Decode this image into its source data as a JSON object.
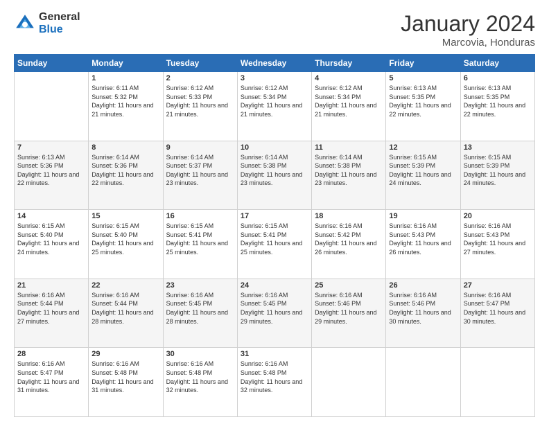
{
  "header": {
    "logo": {
      "general": "General",
      "blue": "Blue"
    },
    "title": "January 2024",
    "subtitle": "Marcovia, Honduras"
  },
  "weekdays": [
    "Sunday",
    "Monday",
    "Tuesday",
    "Wednesday",
    "Thursday",
    "Friday",
    "Saturday"
  ],
  "weeks": [
    [
      {
        "day": "",
        "sunrise": "",
        "sunset": "",
        "daylight": ""
      },
      {
        "day": "1",
        "sunrise": "Sunrise: 6:11 AM",
        "sunset": "Sunset: 5:32 PM",
        "daylight": "Daylight: 11 hours and 21 minutes."
      },
      {
        "day": "2",
        "sunrise": "Sunrise: 6:12 AM",
        "sunset": "Sunset: 5:33 PM",
        "daylight": "Daylight: 11 hours and 21 minutes."
      },
      {
        "day": "3",
        "sunrise": "Sunrise: 6:12 AM",
        "sunset": "Sunset: 5:34 PM",
        "daylight": "Daylight: 11 hours and 21 minutes."
      },
      {
        "day": "4",
        "sunrise": "Sunrise: 6:12 AM",
        "sunset": "Sunset: 5:34 PM",
        "daylight": "Daylight: 11 hours and 21 minutes."
      },
      {
        "day": "5",
        "sunrise": "Sunrise: 6:13 AM",
        "sunset": "Sunset: 5:35 PM",
        "daylight": "Daylight: 11 hours and 22 minutes."
      },
      {
        "day": "6",
        "sunrise": "Sunrise: 6:13 AM",
        "sunset": "Sunset: 5:35 PM",
        "daylight": "Daylight: 11 hours and 22 minutes."
      }
    ],
    [
      {
        "day": "7",
        "sunrise": "Sunrise: 6:13 AM",
        "sunset": "Sunset: 5:36 PM",
        "daylight": "Daylight: 11 hours and 22 minutes."
      },
      {
        "day": "8",
        "sunrise": "Sunrise: 6:14 AM",
        "sunset": "Sunset: 5:36 PM",
        "daylight": "Daylight: 11 hours and 22 minutes."
      },
      {
        "day": "9",
        "sunrise": "Sunrise: 6:14 AM",
        "sunset": "Sunset: 5:37 PM",
        "daylight": "Daylight: 11 hours and 23 minutes."
      },
      {
        "day": "10",
        "sunrise": "Sunrise: 6:14 AM",
        "sunset": "Sunset: 5:38 PM",
        "daylight": "Daylight: 11 hours and 23 minutes."
      },
      {
        "day": "11",
        "sunrise": "Sunrise: 6:14 AM",
        "sunset": "Sunset: 5:38 PM",
        "daylight": "Daylight: 11 hours and 23 minutes."
      },
      {
        "day": "12",
        "sunrise": "Sunrise: 6:15 AM",
        "sunset": "Sunset: 5:39 PM",
        "daylight": "Daylight: 11 hours and 24 minutes."
      },
      {
        "day": "13",
        "sunrise": "Sunrise: 6:15 AM",
        "sunset": "Sunset: 5:39 PM",
        "daylight": "Daylight: 11 hours and 24 minutes."
      }
    ],
    [
      {
        "day": "14",
        "sunrise": "Sunrise: 6:15 AM",
        "sunset": "Sunset: 5:40 PM",
        "daylight": "Daylight: 11 hours and 24 minutes."
      },
      {
        "day": "15",
        "sunrise": "Sunrise: 6:15 AM",
        "sunset": "Sunset: 5:40 PM",
        "daylight": "Daylight: 11 hours and 25 minutes."
      },
      {
        "day": "16",
        "sunrise": "Sunrise: 6:15 AM",
        "sunset": "Sunset: 5:41 PM",
        "daylight": "Daylight: 11 hours and 25 minutes."
      },
      {
        "day": "17",
        "sunrise": "Sunrise: 6:15 AM",
        "sunset": "Sunset: 5:41 PM",
        "daylight": "Daylight: 11 hours and 25 minutes."
      },
      {
        "day": "18",
        "sunrise": "Sunrise: 6:16 AM",
        "sunset": "Sunset: 5:42 PM",
        "daylight": "Daylight: 11 hours and 26 minutes."
      },
      {
        "day": "19",
        "sunrise": "Sunrise: 6:16 AM",
        "sunset": "Sunset: 5:43 PM",
        "daylight": "Daylight: 11 hours and 26 minutes."
      },
      {
        "day": "20",
        "sunrise": "Sunrise: 6:16 AM",
        "sunset": "Sunset: 5:43 PM",
        "daylight": "Daylight: 11 hours and 27 minutes."
      }
    ],
    [
      {
        "day": "21",
        "sunrise": "Sunrise: 6:16 AM",
        "sunset": "Sunset: 5:44 PM",
        "daylight": "Daylight: 11 hours and 27 minutes."
      },
      {
        "day": "22",
        "sunrise": "Sunrise: 6:16 AM",
        "sunset": "Sunset: 5:44 PM",
        "daylight": "Daylight: 11 hours and 28 minutes."
      },
      {
        "day": "23",
        "sunrise": "Sunrise: 6:16 AM",
        "sunset": "Sunset: 5:45 PM",
        "daylight": "Daylight: 11 hours and 28 minutes."
      },
      {
        "day": "24",
        "sunrise": "Sunrise: 6:16 AM",
        "sunset": "Sunset: 5:45 PM",
        "daylight": "Daylight: 11 hours and 29 minutes."
      },
      {
        "day": "25",
        "sunrise": "Sunrise: 6:16 AM",
        "sunset": "Sunset: 5:46 PM",
        "daylight": "Daylight: 11 hours and 29 minutes."
      },
      {
        "day": "26",
        "sunrise": "Sunrise: 6:16 AM",
        "sunset": "Sunset: 5:46 PM",
        "daylight": "Daylight: 11 hours and 30 minutes."
      },
      {
        "day": "27",
        "sunrise": "Sunrise: 6:16 AM",
        "sunset": "Sunset: 5:47 PM",
        "daylight": "Daylight: 11 hours and 30 minutes."
      }
    ],
    [
      {
        "day": "28",
        "sunrise": "Sunrise: 6:16 AM",
        "sunset": "Sunset: 5:47 PM",
        "daylight": "Daylight: 11 hours and 31 minutes."
      },
      {
        "day": "29",
        "sunrise": "Sunrise: 6:16 AM",
        "sunset": "Sunset: 5:48 PM",
        "daylight": "Daylight: 11 hours and 31 minutes."
      },
      {
        "day": "30",
        "sunrise": "Sunrise: 6:16 AM",
        "sunset": "Sunset: 5:48 PM",
        "daylight": "Daylight: 11 hours and 32 minutes."
      },
      {
        "day": "31",
        "sunrise": "Sunrise: 6:16 AM",
        "sunset": "Sunset: 5:48 PM",
        "daylight": "Daylight: 11 hours and 32 minutes."
      },
      {
        "day": "",
        "sunrise": "",
        "sunset": "",
        "daylight": ""
      },
      {
        "day": "",
        "sunrise": "",
        "sunset": "",
        "daylight": ""
      },
      {
        "day": "",
        "sunrise": "",
        "sunset": "",
        "daylight": ""
      }
    ]
  ]
}
